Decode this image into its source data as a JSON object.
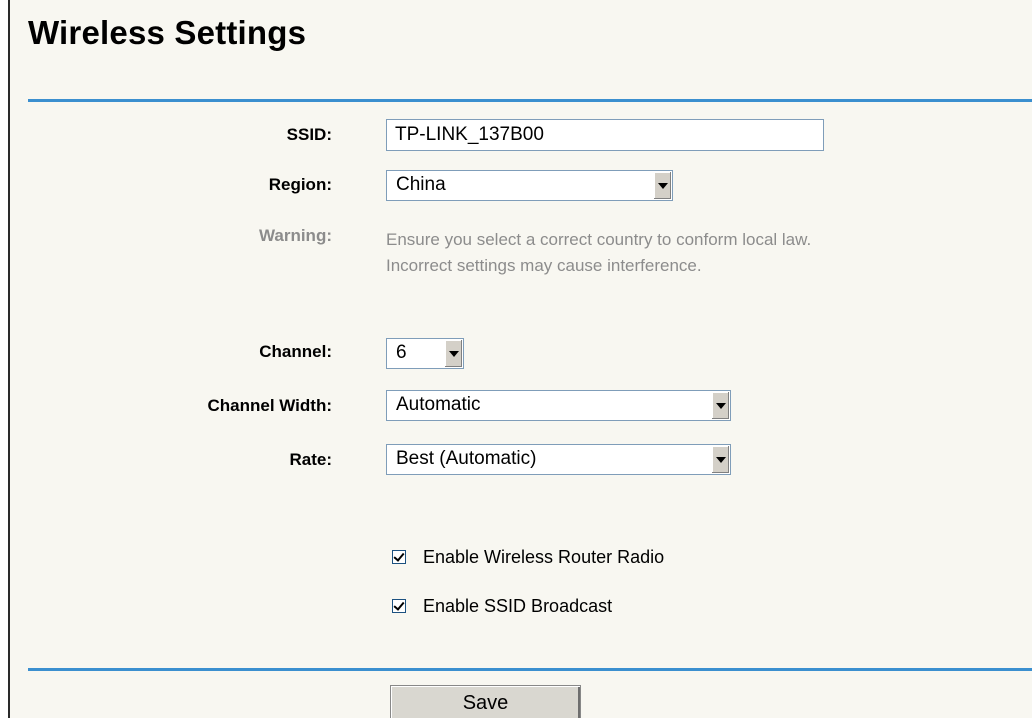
{
  "page": {
    "title": "Wireless Settings"
  },
  "form": {
    "ssid": {
      "label": "SSID:",
      "value": "TP-LINK_137B00"
    },
    "region": {
      "label": "Region:",
      "selected": "China"
    },
    "warning": {
      "label": "Warning:",
      "line1": "Ensure you select a correct country to conform local law.",
      "line2": "Incorrect settings may cause interference."
    },
    "channel": {
      "label": "Channel:",
      "selected": "6"
    },
    "channel_width": {
      "label": "Channel Width:",
      "selected": "Automatic"
    },
    "rate": {
      "label": "Rate:",
      "selected": "Best (Automatic)"
    },
    "checkboxes": {
      "radio": {
        "label": "Enable Wireless Router Radio",
        "checked": true
      },
      "ssid_broadcast": {
        "label": "Enable SSID Broadcast",
        "checked": true
      }
    },
    "save_label": "Save"
  },
  "colors": {
    "rule": "#3b8fcf",
    "background": "#f8f7f1",
    "muted_text": "#8c8c8c"
  }
}
